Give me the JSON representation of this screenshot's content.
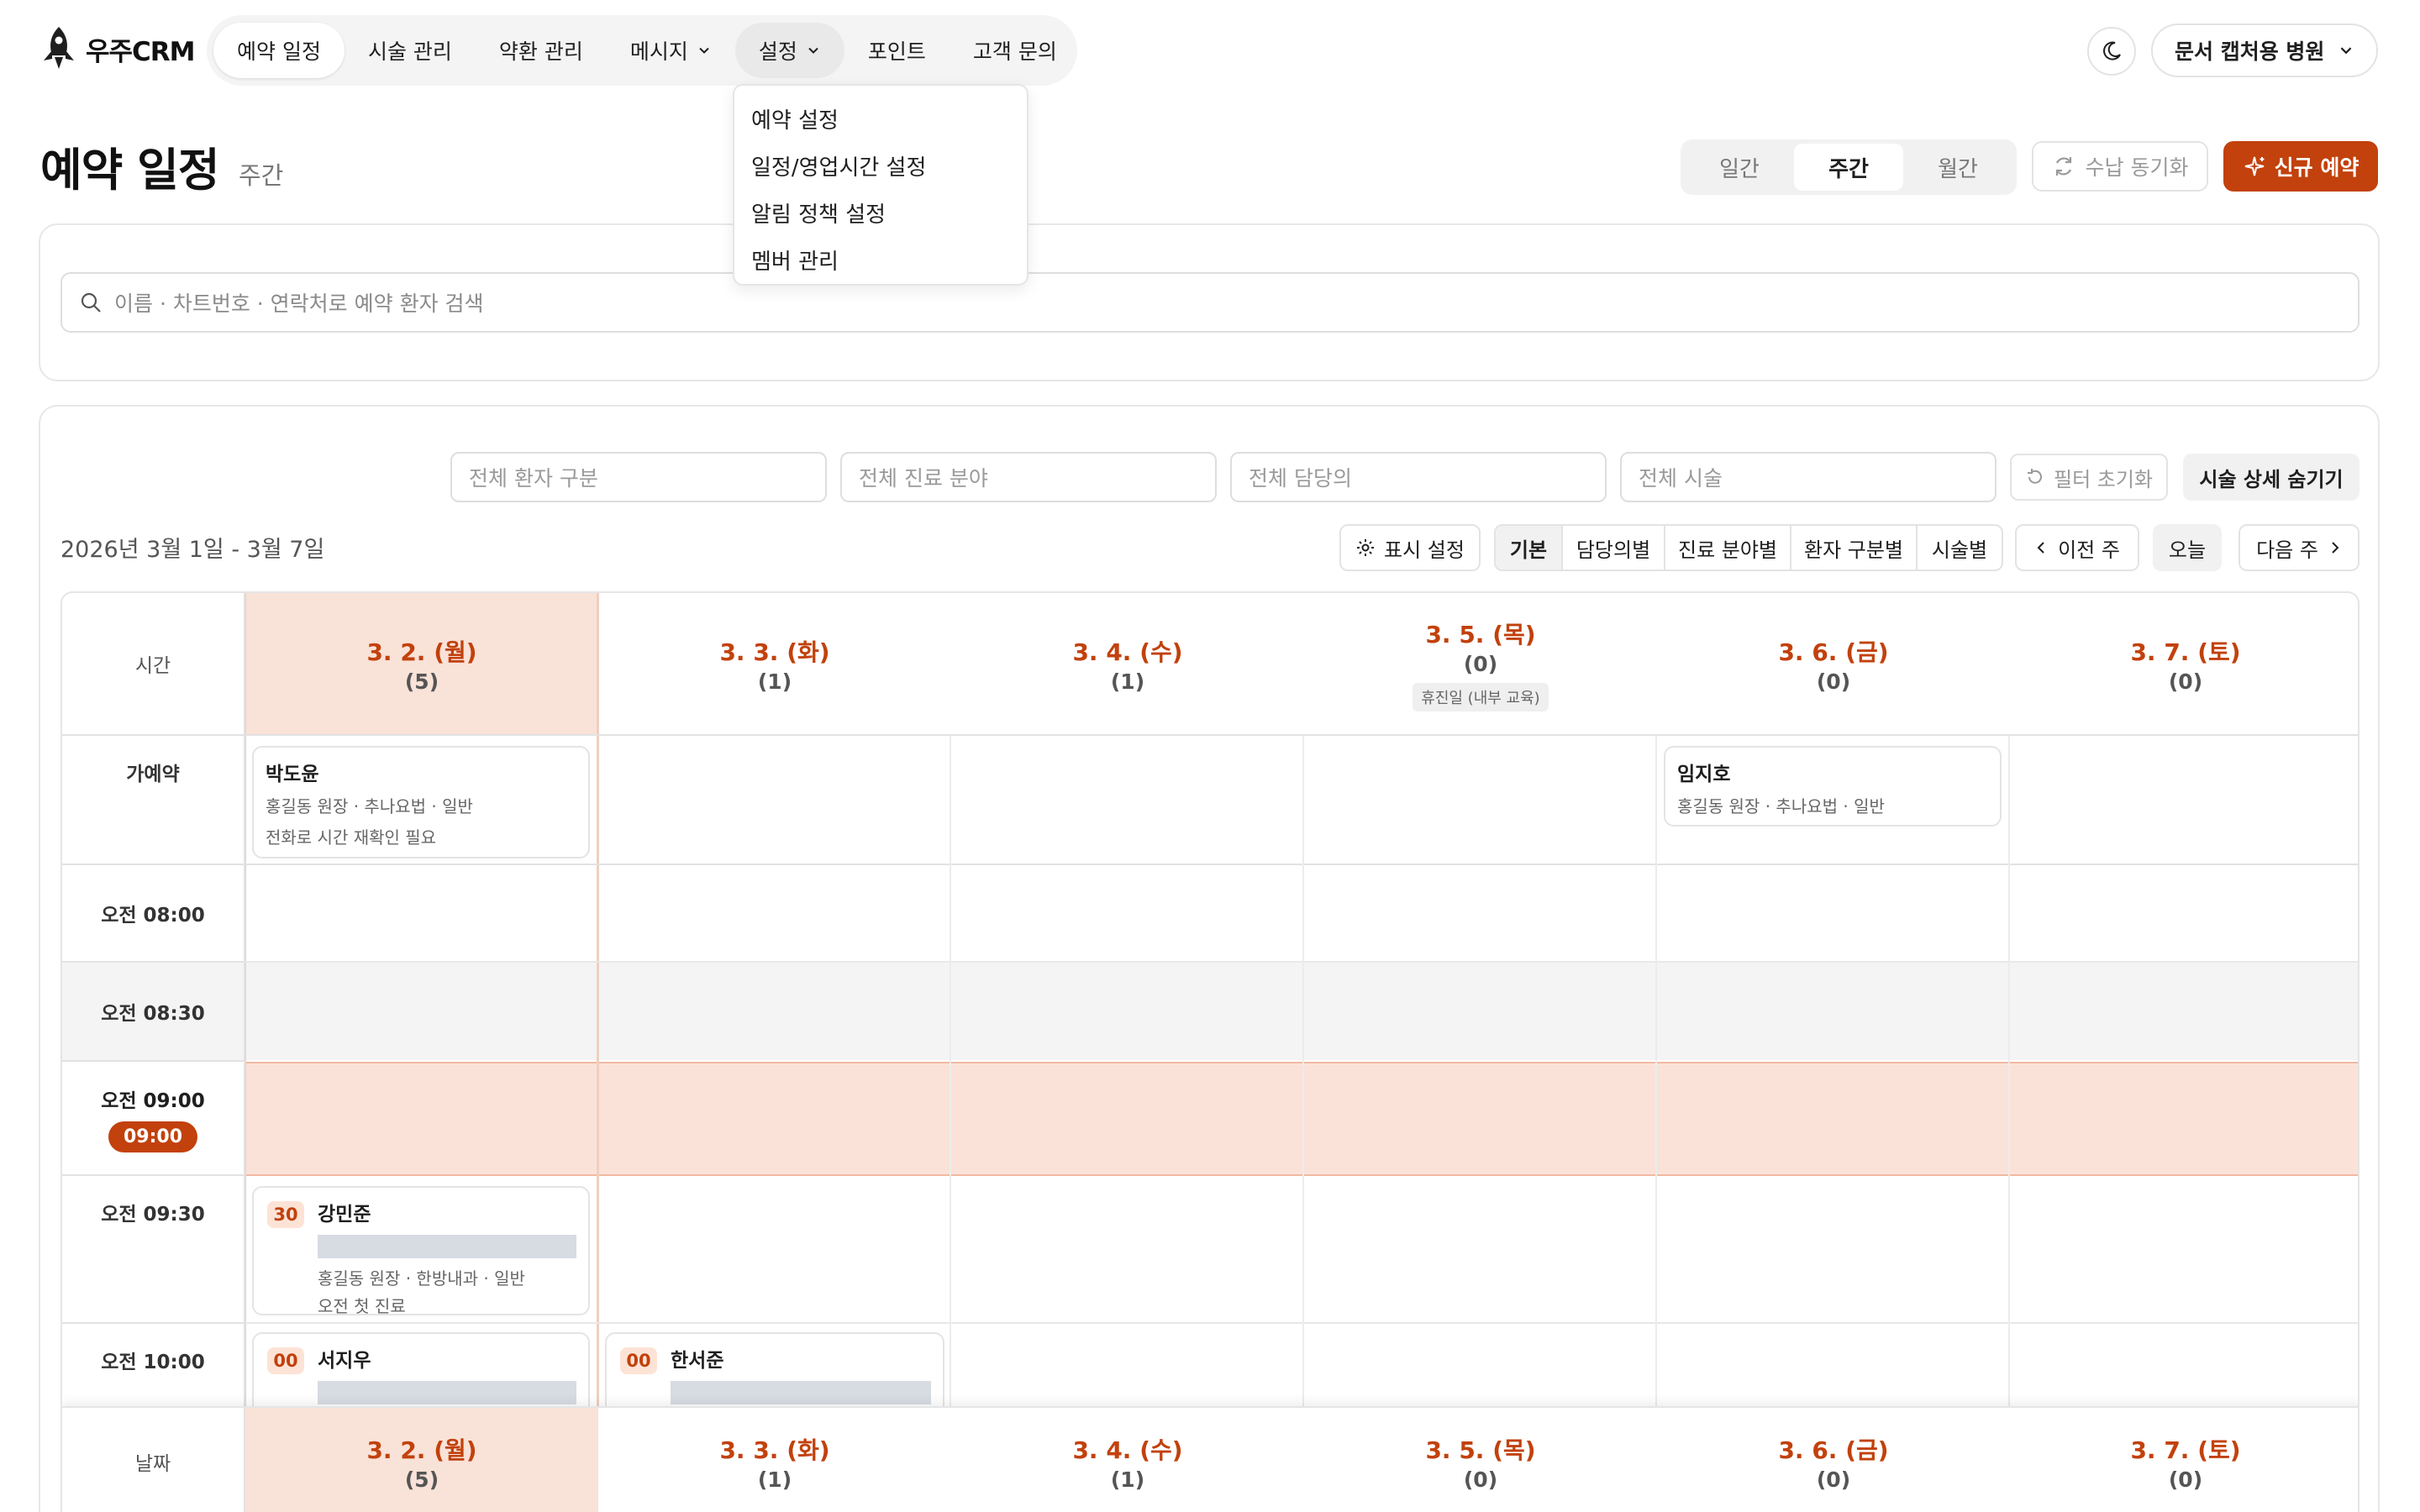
{
  "app": {
    "logo_text": "우주CRM"
  },
  "nav": {
    "items": [
      {
        "label": "예약 일정"
      },
      {
        "label": "시술 관리"
      },
      {
        "label": "약환 관리"
      },
      {
        "label": "메시지"
      },
      {
        "label": "설정"
      },
      {
        "label": "포인트"
      },
      {
        "label": "고객 문의"
      }
    ]
  },
  "settings_menu": {
    "items": [
      "예약 설정",
      "일정/영업시간 설정",
      "알림 정책 설정",
      "멤버 관리"
    ]
  },
  "clinic": {
    "name": "문서 캡처용 병원"
  },
  "page": {
    "title": "예약 일정",
    "subtitle": "주간"
  },
  "view_tabs": [
    "일간",
    "주간",
    "월간"
  ],
  "actions": {
    "sync": "수납 동기화",
    "new": "신규 예약"
  },
  "search": {
    "placeholder": "이름 · 차트번호 · 연락처로 예약 환자 검색"
  },
  "filters": {
    "patient_type": "전체 환자 구분",
    "department": "전체 진료 분야",
    "doctor": "전체 담당의",
    "procedure": "전체 시술",
    "reset": "필터 초기화",
    "hide_detail": "시술 상세 숨기기"
  },
  "toolbar": {
    "date_range": "2026년 3월 1일 - 3월 7일",
    "display_settings": "표시 설정",
    "groupings": [
      "기본",
      "담당의별",
      "진료 분야별",
      "환자 구분별",
      "시술별"
    ],
    "prev": "이전 주",
    "today": "오늘",
    "next": "다음 주"
  },
  "calendar": {
    "time_header": "시간",
    "date_footer": "날짜",
    "days": [
      {
        "date": "3. 2. (월)",
        "count": "(5)",
        "holiday": ""
      },
      {
        "date": "3. 3. (화)",
        "count": "(1)",
        "holiday": ""
      },
      {
        "date": "3. 4. (수)",
        "count": "(1)",
        "holiday": ""
      },
      {
        "date": "3. 5. (목)",
        "count": "(0)",
        "holiday": "휴진일 (내부 교육)"
      },
      {
        "date": "3. 6. (금)",
        "count": "(0)",
        "holiday": ""
      },
      {
        "date": "3. 7. (토)",
        "count": "(0)",
        "holiday": ""
      }
    ],
    "rows": [
      {
        "label": "가예약"
      },
      {
        "label": "오전 08:00"
      },
      {
        "label": "오전 08:30"
      },
      {
        "label": "오전 09:00",
        "now": "09:00"
      },
      {
        "label": "오전 09:30"
      },
      {
        "label": "오전 10:00"
      }
    ],
    "tentative": [
      {
        "name": "박도윤",
        "detail": "홍길동 원장 · 추나요법 · 일반",
        "note": "전화로 시간 재확인 필요"
      },
      {
        "name": "임지호",
        "detail": "홍길동 원장 · 추나요법 · 일반",
        "note": ""
      }
    ],
    "appointments": [
      {
        "badge": "30",
        "name": "강민준",
        "detail": "홍길동 원장 · 한방내과 · 일반",
        "note": "오전 첫 진료"
      },
      {
        "badge": "00",
        "name": "서지우",
        "detail": "",
        "note": ""
      },
      {
        "badge": "00",
        "name": "한서준",
        "detail": "",
        "note": ""
      }
    ]
  },
  "colors": {
    "accent": "#c2410c",
    "today_bg": "#f9e2d8",
    "now_row": "#fbe2d8",
    "closed_row": "#f4f4f4"
  }
}
